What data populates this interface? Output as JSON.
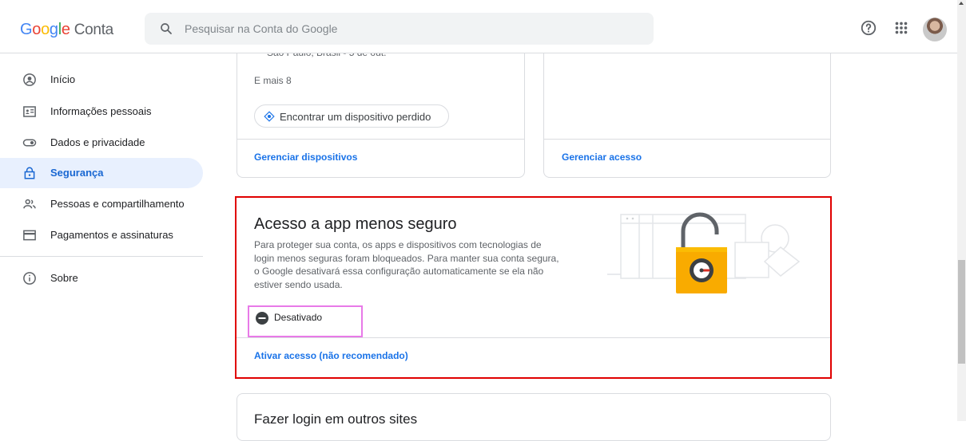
{
  "header": {
    "logo_google": [
      "G",
      "o",
      "o",
      "g",
      "l",
      "e"
    ],
    "logo_suffix": "Conta",
    "search_placeholder": "Pesquisar na Conta do Google",
    "icons": [
      "search-icon",
      "help-icon",
      "apps-icon",
      "avatar"
    ]
  },
  "sidebar": {
    "items": [
      {
        "label": "Início",
        "icon": "account-circle-icon",
        "active": false
      },
      {
        "label": "Informações pessoais",
        "icon": "id-card-icon",
        "active": false
      },
      {
        "label": "Dados e privacidade",
        "icon": "toggle-icon",
        "active": false
      },
      {
        "label": "Segurança",
        "icon": "lock-icon",
        "active": true
      },
      {
        "label": "Pessoas e compartilhamento",
        "icon": "people-icon",
        "active": false
      },
      {
        "label": "Pagamentos e assinaturas",
        "icon": "credit-card-icon",
        "active": false
      },
      {
        "label": "Sobre",
        "icon": "info-icon",
        "active": false
      }
    ]
  },
  "devices_card": {
    "partial_location": "São Paulo, Brasil - 5 de out.",
    "more": "E mais 8",
    "find_device": "Encontrar um dispositivo perdido",
    "manage_link": "Gerenciar dispositivos"
  },
  "access_card": {
    "manage_link": "Gerenciar acesso"
  },
  "less_secure": {
    "title": "Acesso a app menos seguro",
    "description_lines": [
      "Para proteger sua conta, os apps e dispositivos com tecnologias de",
      "login menos seguras foram bloqueados. Para manter sua conta segura,",
      "o Google desativará essa configuração automaticamente se ela não",
      "estiver sendo usada."
    ],
    "status": "Desativado",
    "enable_link": "Ativar acesso (não recomendado)"
  },
  "next_section": {
    "partial_title": "Fazer login em outros sites"
  },
  "colors": {
    "accent": "#1a73e8",
    "active_bg": "#e8f0fe",
    "highlight_red": "#e00000",
    "highlight_pink": "#e87ae8",
    "lock_yellow": "#f9ab00"
  }
}
